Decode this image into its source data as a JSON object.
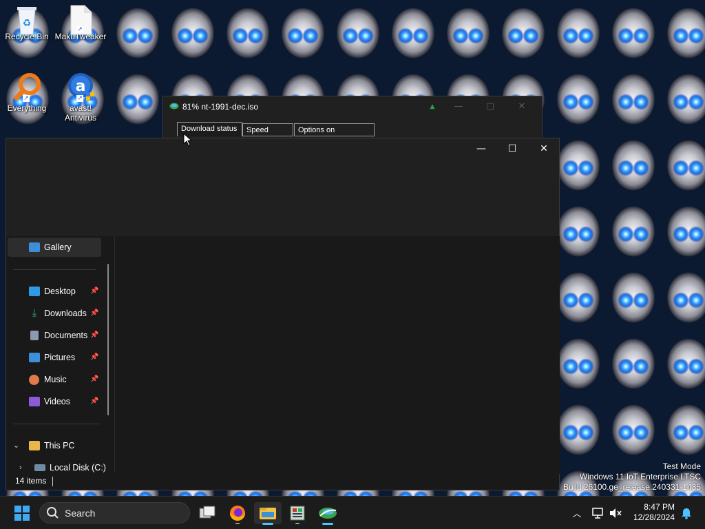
{
  "desktop": {
    "icons": [
      {
        "label": "Recycle Bin",
        "icon": "recycle-bin-icon"
      },
      {
        "label": "MakuTweaker",
        "icon": "file-shortcut-icon"
      },
      {
        "label": "Everything",
        "icon": "everything-search-icon"
      },
      {
        "label": "avast! Antivirus",
        "icon": "avast-icon"
      }
    ],
    "watermark": {
      "line1": "Test Mode",
      "line2": "Windows 11 IoT Enterprise LTSC",
      "line3": "Build 26100.ge_release.240331-1435"
    }
  },
  "download_window": {
    "title": "81% nt-1991-dec.iso",
    "tabs": [
      "Download status",
      "Speed Limiter",
      "Options on completion"
    ],
    "active_tab": "Download status",
    "controls": {
      "minimize": "—",
      "maximize": "▢",
      "close": "✕"
    }
  },
  "explorer": {
    "controls": {
      "minimize": "—",
      "maximize": "☐",
      "close": "✕"
    },
    "nav": {
      "gallery": "Gallery",
      "quick_access": [
        {
          "label": "Desktop",
          "icon": "desktop-icon",
          "color": "#2f9be8"
        },
        {
          "label": "Downloads",
          "icon": "downloads-icon",
          "color": "#2fb36a"
        },
        {
          "label": "Documents",
          "icon": "documents-icon",
          "color": "#8a9bb0"
        },
        {
          "label": "Pictures",
          "icon": "pictures-icon",
          "color": "#3c8fd8"
        },
        {
          "label": "Music",
          "icon": "music-icon",
          "color": "#e07a4a"
        },
        {
          "label": "Videos",
          "icon": "videos-icon",
          "color": "#8c5ad6"
        }
      ],
      "pin_glyph": "📌",
      "this_pc": "This PC",
      "local_disk": "Local Disk (C:)"
    },
    "status": {
      "items": "14 items"
    }
  },
  "taskbar": {
    "search_label": "Search",
    "apps": [
      "start-icon",
      "task-view-icon",
      "firefox-icon",
      "file-explorer-icon",
      "app-icon",
      "download-manager-icon"
    ],
    "time": "8:47 PM",
    "date": "12/28/2024"
  },
  "colors": {
    "accent": "#4cc2ff",
    "window_bg": "#191919",
    "taskbar_bg": "#1c1c1c"
  }
}
